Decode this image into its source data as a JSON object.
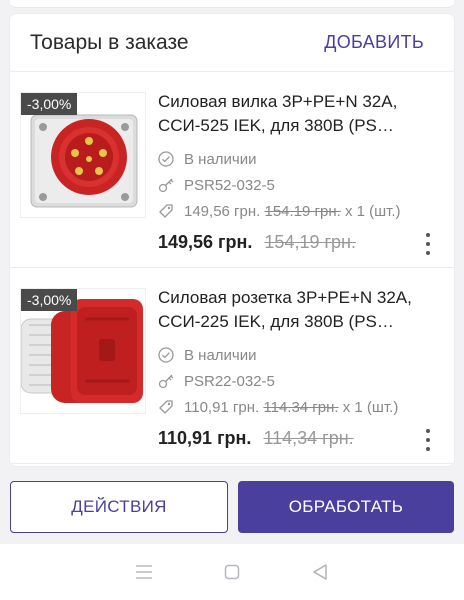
{
  "header": {
    "title": "Товары в заказе",
    "add_label": "ДОБАВИТЬ"
  },
  "items": [
    {
      "discount": "-3,00%",
      "name": "Силовая вилка 3Р+РЕ+N 32А, ССИ-525 IEK, для 380В (PS…",
      "stock": "В наличии",
      "sku": "PSR52-032-5",
      "unit_price": "149,56 грн.",
      "unit_old_price": "154.19 грн.",
      "qty_text": "x 1 (шт.)",
      "price": "149,56 грн.",
      "old_price": "154,19 грн.",
      "image_icon": "power-plug-image"
    },
    {
      "discount": "-3,00%",
      "name": "Силовая розетка 3Р+РЕ+N 32А, ССИ-225 IEK, для 380В (PS…",
      "stock": "В наличии",
      "sku": "PSR22-032-5",
      "unit_price": "110,91 грн.",
      "unit_old_price": "114.34 грн.",
      "qty_text": "x 1 (шт.)",
      "price": "110,91 грн.",
      "old_price": "114,34 грн.",
      "image_icon": "power-socket-image"
    }
  ],
  "actions": {
    "secondary_label": "ДЕЙСТВИЯ",
    "primary_label": "ОБРАБОТАТЬ"
  },
  "colors": {
    "accent": "#4b3f9e",
    "discount_badge": "#4a4a4a",
    "product_red": "#d42a2a"
  },
  "navbar": {
    "icons": [
      "menu-icon",
      "home-square-icon",
      "back-triangle-icon"
    ]
  }
}
